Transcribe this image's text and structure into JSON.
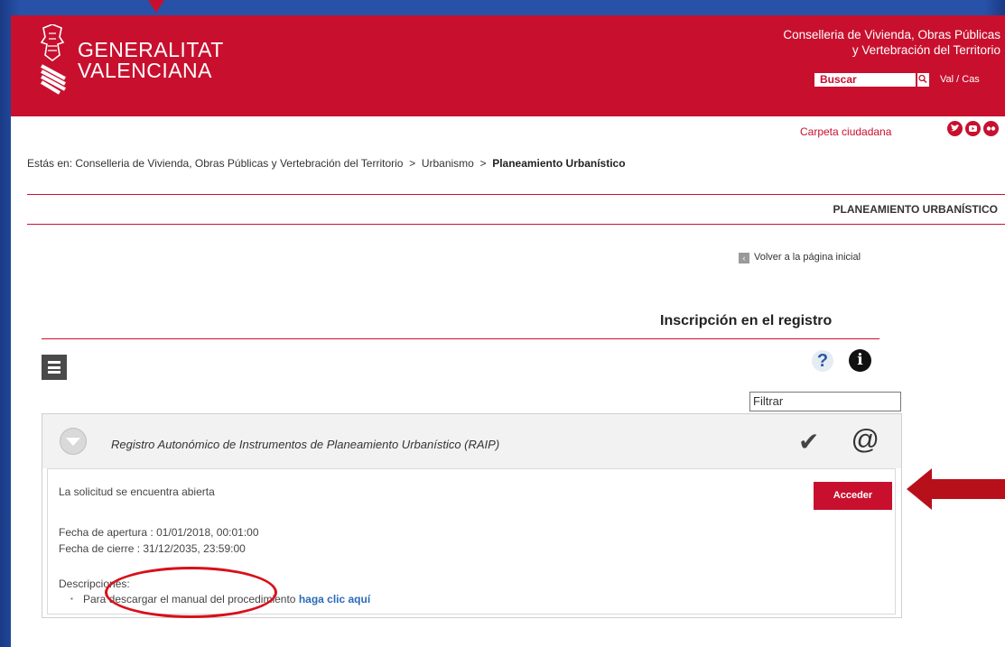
{
  "header": {
    "logo_line1": "GENERALITAT",
    "logo_line2": "VALENCIANA",
    "department_line1": "Conselleria de Vivienda, Obras Públicas",
    "department_line2": "y Vertebración del Territorio",
    "search_label": "Buscar",
    "language_links": "Val / Cas",
    "carpeta_link": "Carpeta ciudadana",
    "brand_color": "#c8102e"
  },
  "breadcrumb": {
    "prefix": "Estás en: ",
    "item1": "Conselleria de Vivienda, Obras Públicas y Vertebración del Territorio",
    "separator1": "  >  ",
    "item2": "Urbanismo",
    "separator2": "  >  ",
    "current": "Planeamiento Urbanístico"
  },
  "section": {
    "title": "PLANEAMIENTO URBANÍSTICO",
    "back_link": "Volver a la página inicial",
    "heading": "Inscripción en el registro"
  },
  "toolbar": {
    "help_symbol": "?",
    "info_symbol": "i",
    "filter_placeholder": "Filtrar"
  },
  "procedure": {
    "title": "Registro Autonómico de Instrumentos de Planeamiento Urbanístico (RAIP)",
    "status": "La solicitud se encuentra abierta",
    "access_button": "Acceder",
    "opening_date": "Fecha de apertura : 01/01/2018, 00:01:00",
    "closing_date": "Fecha de cierre : 31/12/2035, 23:59:00",
    "descriptions_label": "Descripciones:",
    "manual_text": "Para descargar el manual del procedimiento ",
    "manual_link": "haga clic aquí"
  }
}
